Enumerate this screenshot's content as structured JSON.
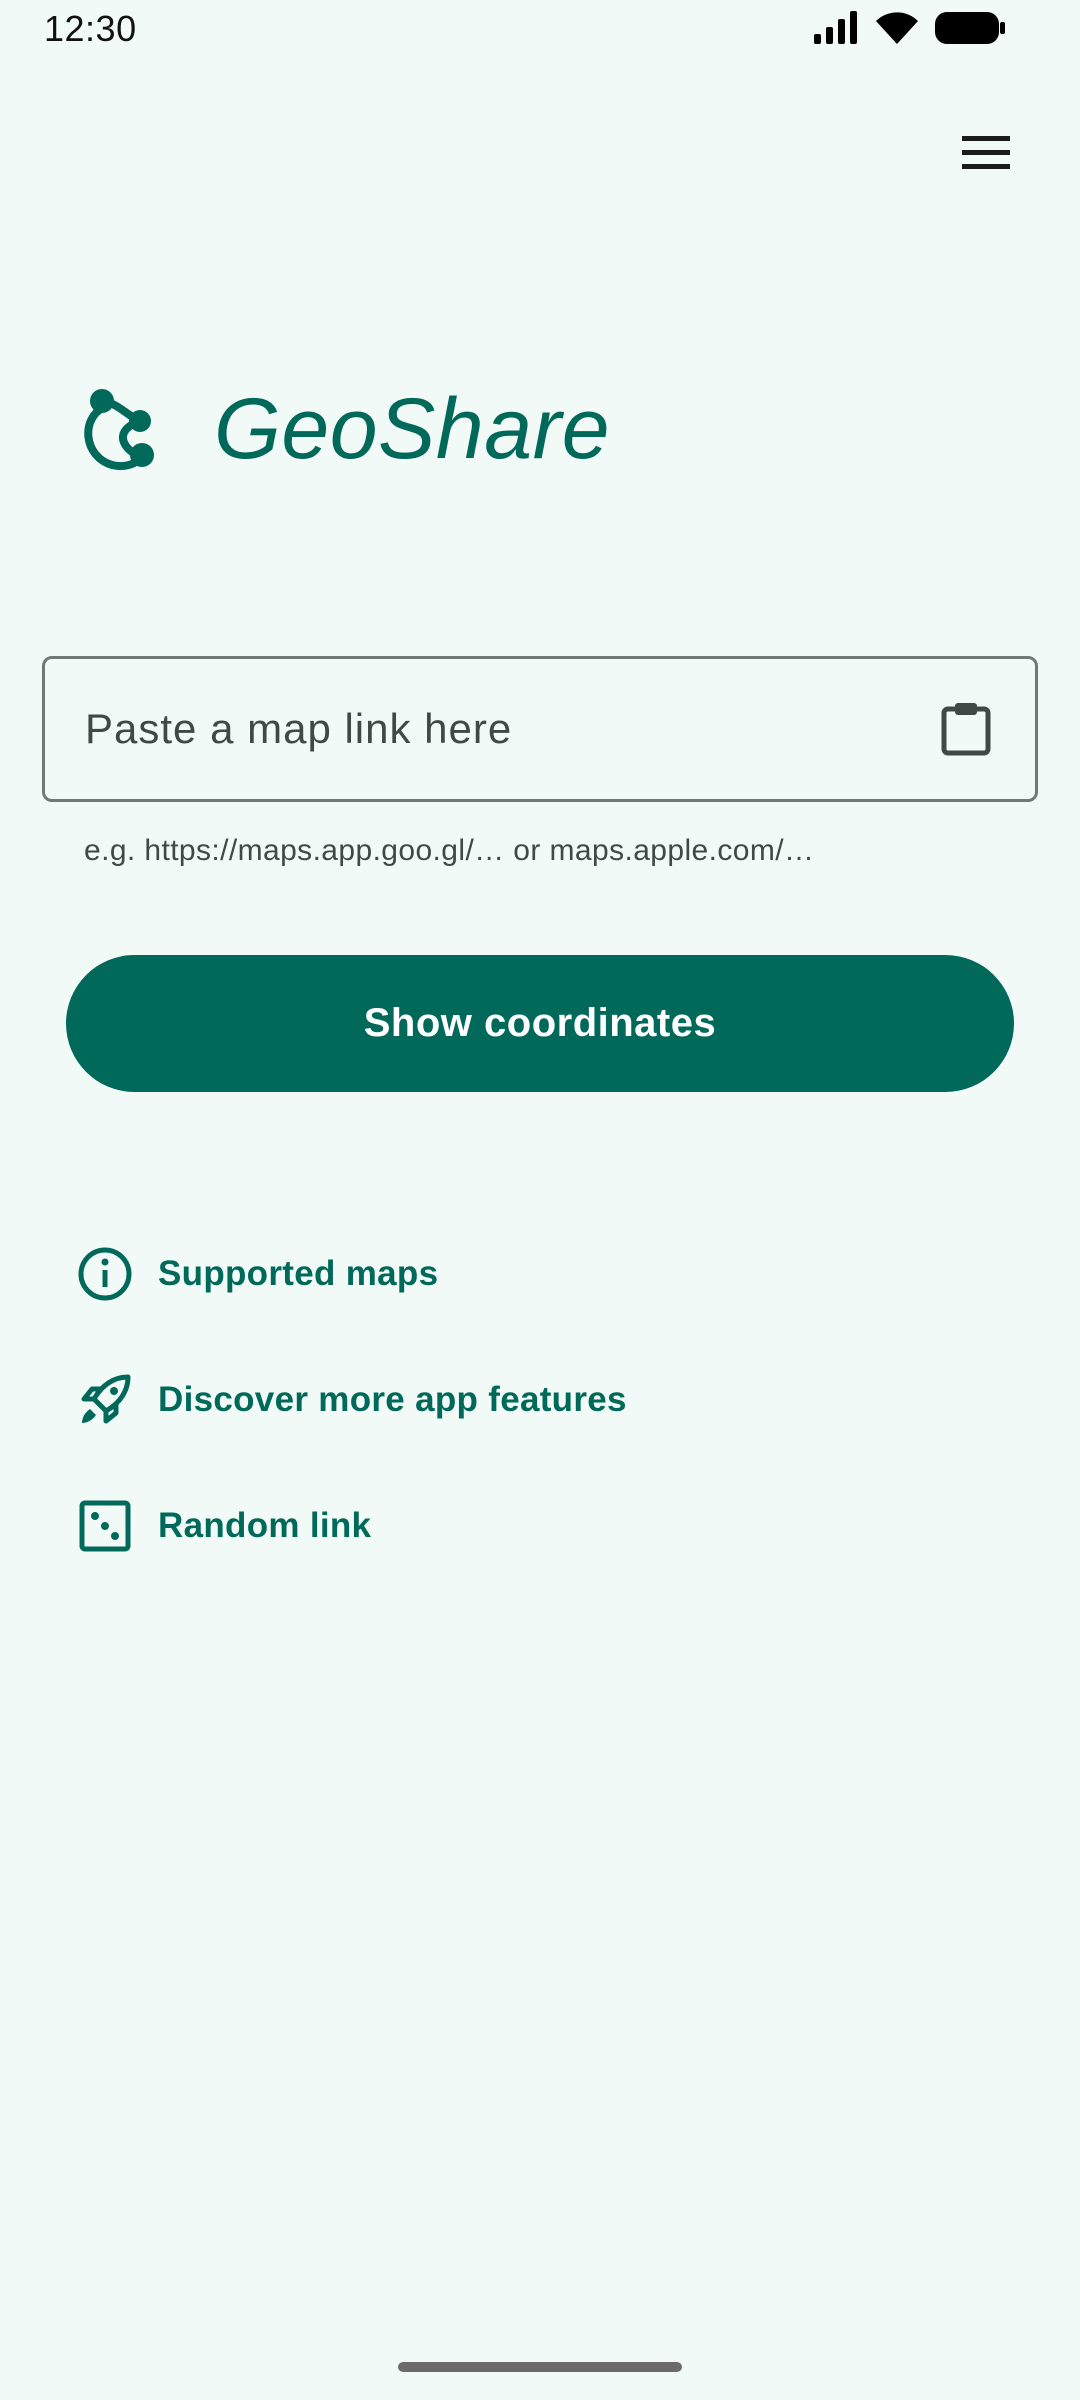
{
  "status_bar": {
    "time": "12:30"
  },
  "app": {
    "title": "GeoShare"
  },
  "input": {
    "placeholder": "Paste a map link here",
    "value": ""
  },
  "helper_text": "e.g. https://maps.app.goo.gl/… or maps.apple.com/…",
  "primary_button": {
    "label": "Show coordinates"
  },
  "links": [
    {
      "label": "Supported maps",
      "icon": "info-icon"
    },
    {
      "label": "Discover more app features",
      "icon": "rocket-icon"
    },
    {
      "label": "Random link",
      "icon": "dice-icon"
    }
  ],
  "colors": {
    "primary": "#00695a",
    "background": "#f1faf6",
    "outline": "#6f7975"
  }
}
